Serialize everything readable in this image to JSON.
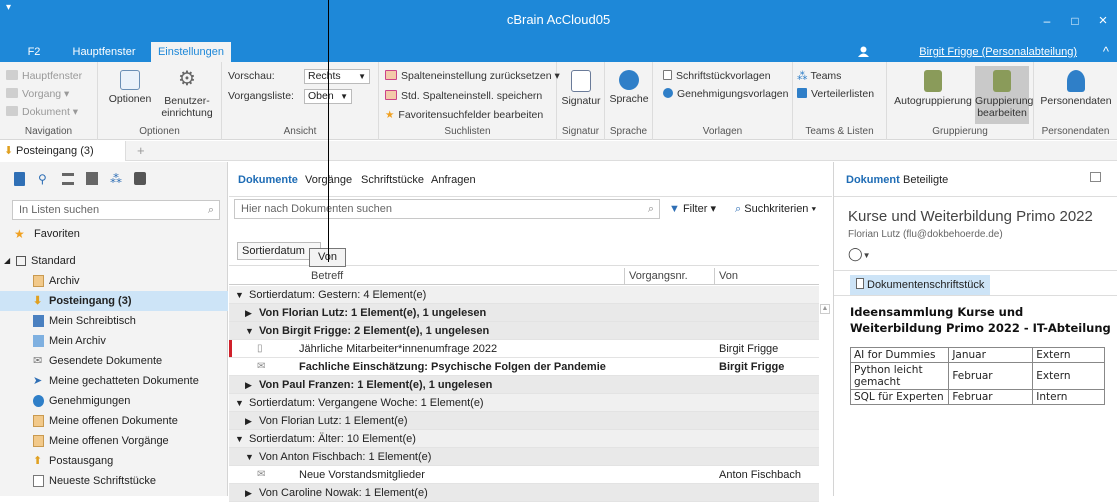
{
  "window": {
    "title": "cBrain AcCloud05",
    "minimize_glyph": "–",
    "maximize_glyph": "□",
    "close_glyph": "×",
    "quickaccess_glyph": "▾"
  },
  "menubar": {
    "tabs": [
      "F2",
      "Hauptfenster",
      "Einstellungen"
    ],
    "active": "Einstellungen",
    "user": "Birgit Frigge (Personalabteilung)",
    "collapse_glyph": "^"
  },
  "ribbon": {
    "navigation": {
      "items": [
        "Hauptfenster",
        "Vorgang ▾",
        "Dokument ▾"
      ],
      "label": "Navigation"
    },
    "optionen": {
      "optionen": "Optionen",
      "benutzer": "Benutzer-",
      "benutzer2": "einrichtung",
      "label": "Optionen"
    },
    "ansicht": {
      "vorschau_label": "Vorschau:",
      "vorschau_value": "Rechts",
      "vorgangsliste_label": "Vorgangsliste:",
      "vorgangsliste_value": "Oben",
      "label": "Ansicht"
    },
    "suchlisten": {
      "items": [
        "Spalteneinstellung zurücksetzen ▾",
        "Std. Spalteneinstell. speichern",
        "Favoritensuchfelder bearbeiten"
      ],
      "label": "Suchlisten"
    },
    "signatur": {
      "button": "Signatur",
      "label": "Signatur"
    },
    "sprache": {
      "button": "Sprache",
      "label": "Sprache"
    },
    "vorlagen": {
      "items": [
        "Schriftstückvorlagen",
        "Genehmigungsvorlagen"
      ],
      "label": "Vorlagen"
    },
    "teams": {
      "items": [
        "Teams",
        "Verteilerlisten"
      ],
      "label": "Teams & Listen"
    },
    "gruppierung": {
      "auto": "Autogruppierung",
      "gruppierung": "Gruppierung",
      "gruppierung2": "bearbeiten",
      "label": "Gruppierung"
    },
    "personendaten": {
      "button": "Personendaten",
      "label": "Personendaten"
    }
  },
  "doctabs": {
    "active_tab": "Posteingang (3)",
    "plus": "+"
  },
  "leftpane": {
    "search_placeholder": "In Listen suchen",
    "favoriten": "Favoriten",
    "standard": "Standard",
    "items": [
      "Archiv",
      "Posteingang (3)",
      "Mein Schreibtisch",
      "Mein Archiv",
      "Gesendete Dokumente",
      "Meine gechatteten Dokumente",
      "Genehmigungen",
      "Meine offenen Dokumente",
      "Meine offenen Vorgänge",
      "Postausgang",
      "Neueste Schriftstücke"
    ]
  },
  "centerpane": {
    "tabs": [
      "Dokumente",
      "Vorgänge",
      "Schriftstücke",
      "Anfragen"
    ],
    "active_tab": "Dokumente",
    "search_placeholder": "Hier nach Dokumenten suchen",
    "filter": "Filter ▾",
    "suchkriterien": "Suchkriterien ▾",
    "sort_chip": "Sortierdatum",
    "drag_label": "Von",
    "columns": [
      "Betreff",
      "Vorgangsnr.",
      "Von"
    ],
    "rows": [
      {
        "kind": "g1",
        "text": "Sortierdatum: Gestern: 4 Element(e)",
        "glyph": "▼"
      },
      {
        "kind": "g2b",
        "text": "Von Florian Lutz: 1 Element(e), 1 ungelesen",
        "glyph": "▶"
      },
      {
        "kind": "g2b",
        "text": "Von Birgit Frigge: 2 Element(e), 1 ungelesen",
        "glyph": "▼"
      },
      {
        "kind": "doc",
        "text": "Jährliche Mitarbeiter*innenumfrage 2022",
        "von": "Birgit Frigge",
        "unread": false,
        "flag": true
      },
      {
        "kind": "docb",
        "text": "Fachliche Einschätzung: Psychische Folgen der Pandemie",
        "von": "Birgit Frigge",
        "unread": true,
        "flag": false
      },
      {
        "kind": "g2b",
        "text": "Von Paul Franzen: 1 Element(e), 1 ungelesen",
        "glyph": "▶"
      },
      {
        "kind": "g1",
        "text": "Sortierdatum: Vergangene Woche: 1 Element(e)",
        "glyph": "▼"
      },
      {
        "kind": "g2",
        "text": "Von Florian Lutz: 1 Element(e)",
        "glyph": "▶"
      },
      {
        "kind": "g1",
        "text": "Sortierdatum: Älter: 10 Element(e)",
        "glyph": "▼"
      },
      {
        "kind": "g2",
        "text": "Von Anton Fischbach: 1 Element(e)",
        "glyph": "▼"
      },
      {
        "kind": "doc",
        "text": "Neue Vorstandsmitglieder",
        "von": "Anton Fischbach",
        "unread": false,
        "flag": false
      },
      {
        "kind": "g2",
        "text": "Von Caroline Nowak: 1 Element(e)",
        "glyph": "▶"
      }
    ]
  },
  "rightpane": {
    "tabs": [
      "Dokument",
      "Beteiligte"
    ],
    "active_tab": "Dokument",
    "title": "Kurse und Weiterbildung Primo 2022",
    "author": "Florian Lutz (flu@dokbehoerde.de)",
    "attachment": "Dokumentenschriftstück",
    "heading": "Ideensammlung Kurse und Weiterbildung Primo 2022 - IT-Abteilung",
    "table": [
      [
        "AI for Dummies",
        "Januar",
        "Extern"
      ],
      [
        "Python leicht gemacht",
        "Februar",
        "Extern"
      ],
      [
        "SQL für Experten",
        "Februar",
        "Intern"
      ]
    ]
  }
}
